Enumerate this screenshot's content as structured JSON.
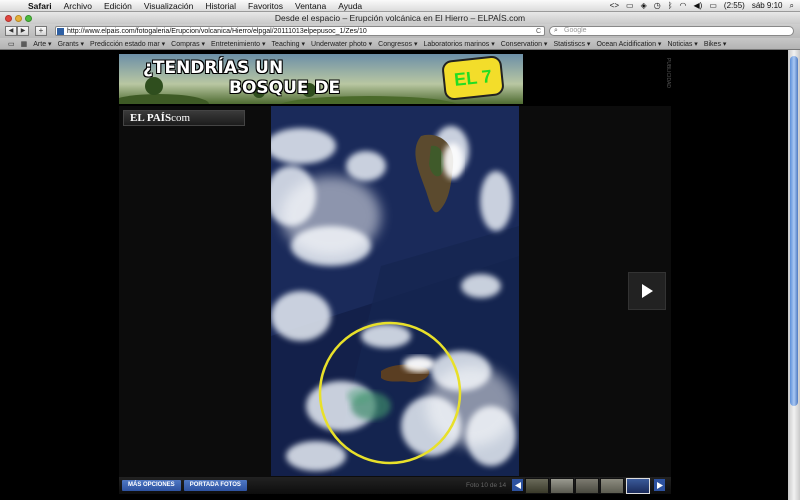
{
  "menubar": {
    "apple_glyph": "",
    "items": [
      "Safari",
      "Archivo",
      "Edición",
      "Visualización",
      "Historial",
      "Favoritos",
      "Ventana",
      "Ayuda"
    ],
    "battery": "(2:55)",
    "clock": "sáb 9:10"
  },
  "window": {
    "title": "Desde el espacio – Erupción volcánica en El Hierro – ELPAÍS.com"
  },
  "toolbar": {
    "back": "◀",
    "forward": "▶",
    "add": "+",
    "url": "http://www.elpais.com/fotogaleria/Erupcion/volcanica/Hierro/elpgal/20111013elpepusoc_1/Zes/10",
    "reload": "C",
    "search_placeholder": "Google"
  },
  "bookmarks": [
    "Arte",
    "Grants",
    "Predicción estado mar",
    "Compras",
    "Entretenimiento",
    "Teaching",
    "Underwater photo",
    "Congresos",
    "Laboratorios marinos",
    "Conservation",
    "Statistiscs",
    "Ocean Acidification",
    "Noticias",
    "Bikes"
  ],
  "banner": {
    "line1": "¿TENDRÍAS UN",
    "line2": "BOSQUE DE",
    "badge": "EL 7",
    "side_label": "PUBLICIDAD"
  },
  "gallery": {
    "logo_main": "EL PAÍS",
    "logo_suffix": "com",
    "more_options": "MÁS OPCIONES",
    "photo_cover": "PORTADA FOTOS",
    "counter": "Foto 10 de 14"
  },
  "colors": {
    "ocean": "#13204a",
    "circle": "#e8e02a",
    "footer_button": "#2d52a0"
  }
}
